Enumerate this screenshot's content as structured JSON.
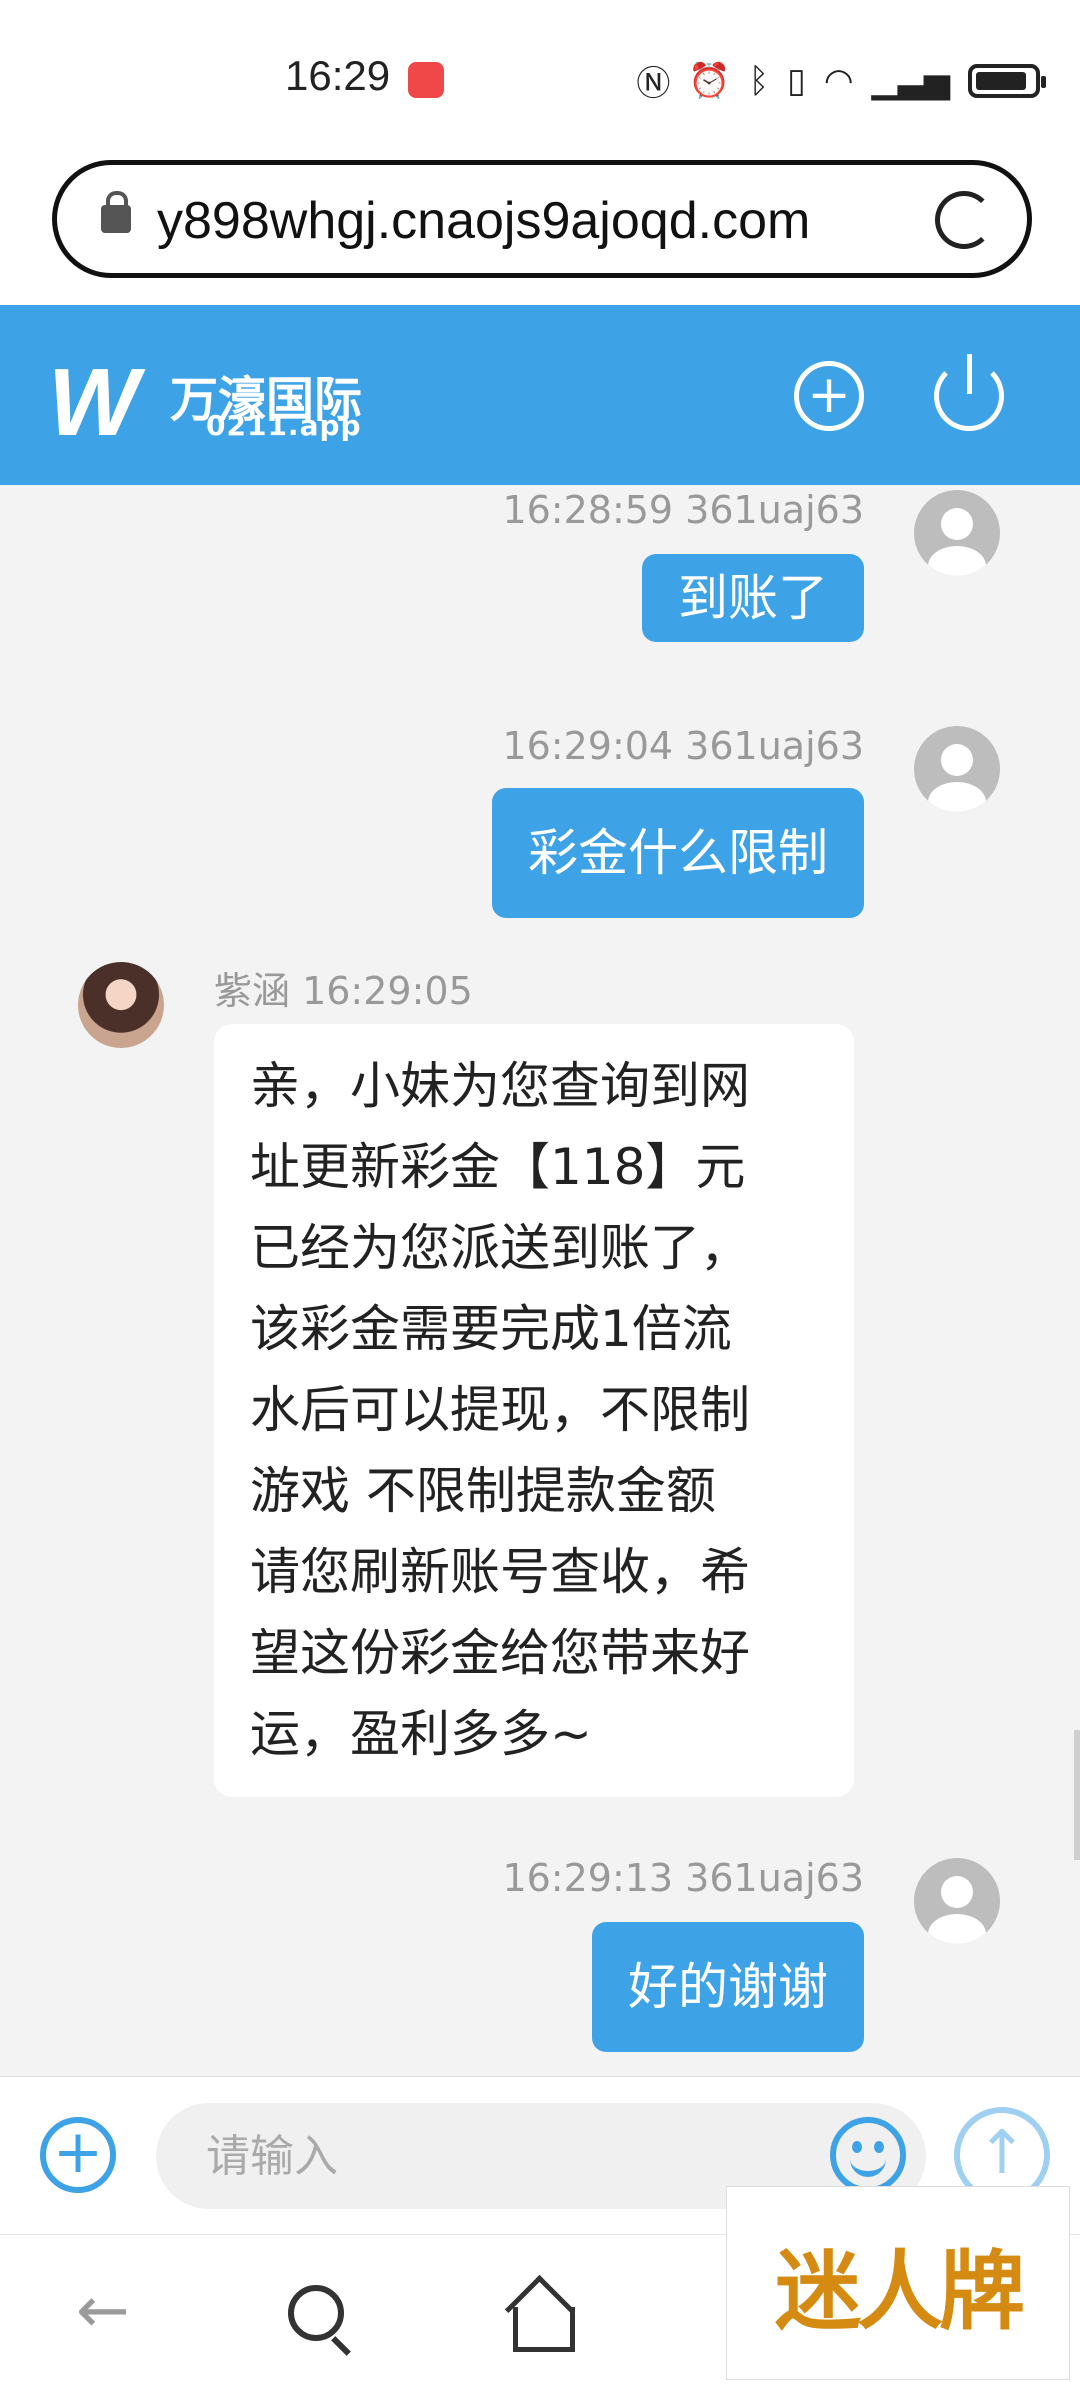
{
  "status_bar": {
    "time": "16:29",
    "icons": [
      "nfc-icon",
      "alarm-icon",
      "bluetooth-icon",
      "vibrate-icon",
      "wifi-icon",
      "signal-5g-icon",
      "battery-icon"
    ]
  },
  "browser": {
    "url": "y898whgj.cnaojs9ajoqd.com"
  },
  "header": {
    "brand_name": "万濠国际",
    "brand_sub": "0211.app",
    "accent": "#3ea2e6"
  },
  "messages": [
    {
      "direction": "out",
      "meta": "16:28:59 361uaj63",
      "text": "到账了"
    },
    {
      "direction": "out",
      "meta": "16:29:04 361uaj63",
      "text": "彩金什么限制"
    },
    {
      "direction": "in",
      "meta": "紫涵 16:29:05",
      "text": "亲，小妹为您查询到网\n址更新彩金【118】元\n已经为您派送到账了，\n该彩金需要完成1倍流\n水后可以提现，不限制\n游戏 不限制提款金额\n请您刷新账号查收，希\n望这份彩金给您带来好\n运，盈利多多~"
    },
    {
      "direction": "out",
      "meta": "16:29:13 361uaj63",
      "text": "好的谢谢"
    }
  ],
  "input": {
    "placeholder": "请输入",
    "value": ""
  },
  "watermark": {
    "text": "迷人牌"
  }
}
